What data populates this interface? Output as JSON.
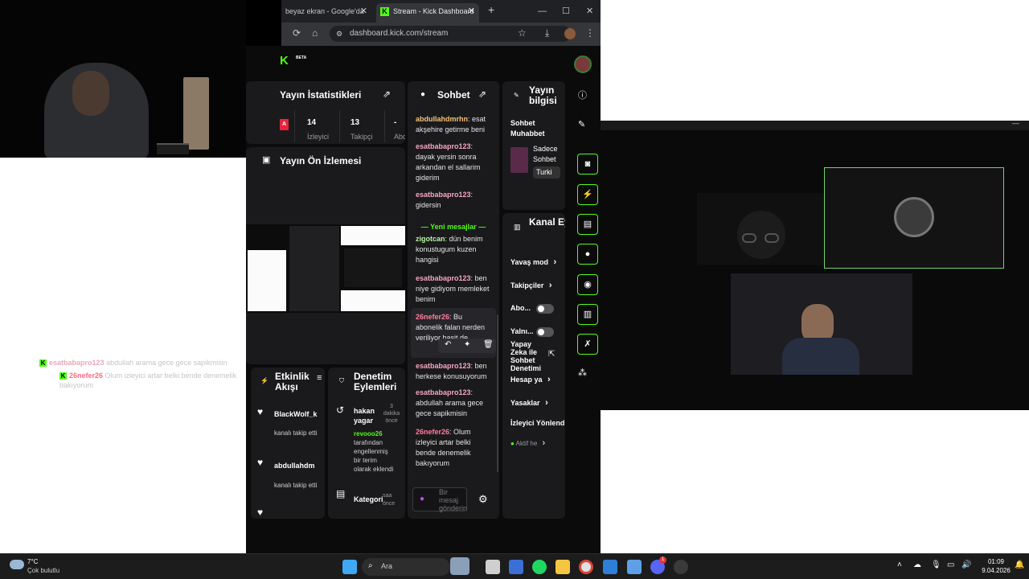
{
  "browser": {
    "tabs": [
      {
        "label": "beyaz ekran - Google'da"
      },
      {
        "label": "Stream - Kick Dashboard"
      }
    ],
    "new_tab": "+",
    "window_controls": {
      "minimize": "—",
      "maximize": "☐",
      "close": "✕"
    },
    "url": "dashboard.kick.com/stream"
  },
  "kick": {
    "logo": "K",
    "beta": "BETA",
    "stats": {
      "title": "Yayın İstatistikleri",
      "badge": "A",
      "viewers_value": "14",
      "viewers_label": "İzleyici",
      "followers_value": "13",
      "followers_label": "Takipçi",
      "subs_value": "-",
      "subs_label": "Abo"
    },
    "preview": {
      "title": "Yayın Ön İzlemesi"
    },
    "activity": {
      "title": "Etkinlik Akışı",
      "items": [
        {
          "name": "BlackWolf_k",
          "text": "kanalı takip etti"
        },
        {
          "name": "abdullahdm",
          "text": "kanalı takip etti"
        }
      ]
    },
    "moderation": {
      "title": "Denetim Eylemleri",
      "items": [
        {
          "user": "hakan yagar",
          "time": "3 dakika önce",
          "actor": "revooo26",
          "text": "tarafından engellenmiş bir terim olarak eklendi"
        },
        {
          "user": "Kategori",
          "time": "saa önce"
        }
      ]
    },
    "chat": {
      "title": "Sohbet",
      "messages": [
        {
          "user": "abdullahdmrhn",
          "text": "esat akşehire getirme beni"
        },
        {
          "user": "esatbabapro123",
          "text": "dayak yersin sonra arkandan el sallarim giderim"
        },
        {
          "user": "esatbabapro123",
          "text": "gidersin"
        },
        {
          "user": "zigotcan",
          "text": "dün benim konustugum kuzen hangisi"
        },
        {
          "user": "esatbabapro123",
          "text": "ben niye gidiyom memleket benim"
        },
        {
          "user": "26nefer26",
          "text": "Bu abonelik falan nerden veriliyor basit de"
        },
        {
          "user": "esatbabapro123",
          "text": "ben herkese konusuyorum"
        },
        {
          "user": "esatbabapro123",
          "text": "abdullah arama gece gece sapikmisin"
        },
        {
          "user": "26nefer26",
          "text": "Olum izleyici artar belki bende denemelik bakıyorum"
        }
      ],
      "new_messages": "Yeni mesajlar",
      "input_placeholder": "Bir mesaj gönderin"
    },
    "stream_info": {
      "title": "Yayın bilgisi",
      "stream_title": "Sohbet Muhabbet",
      "category": "Sadece Sohbet",
      "language": "Turki"
    },
    "channel_actions": {
      "title": "Kanal Eylemleri",
      "items": [
        "Yavaş mod",
        "Takipçiler",
        "Abo...",
        "Yalnı...",
        "Yapay Zeka ile Sohbet Denetimi",
        "Hesap ya",
        "Yasaklar",
        "İzleyici Yönlend"
      ],
      "active": "Aktif he"
    }
  },
  "overlay_chat": [
    {
      "user": "esatbabapro123",
      "text": "abdullah arama gece gece sapikmisin"
    },
    {
      "user": "26nefer26",
      "text": "Olum izleyici artar belki bende denemelik bakıyorum"
    }
  ],
  "taskbar": {
    "temp": "7°C",
    "weather": "Çok bulutlu",
    "search": "Ara",
    "time": "01:09",
    "date": "9.04.2026",
    "notification_badge": "1"
  }
}
